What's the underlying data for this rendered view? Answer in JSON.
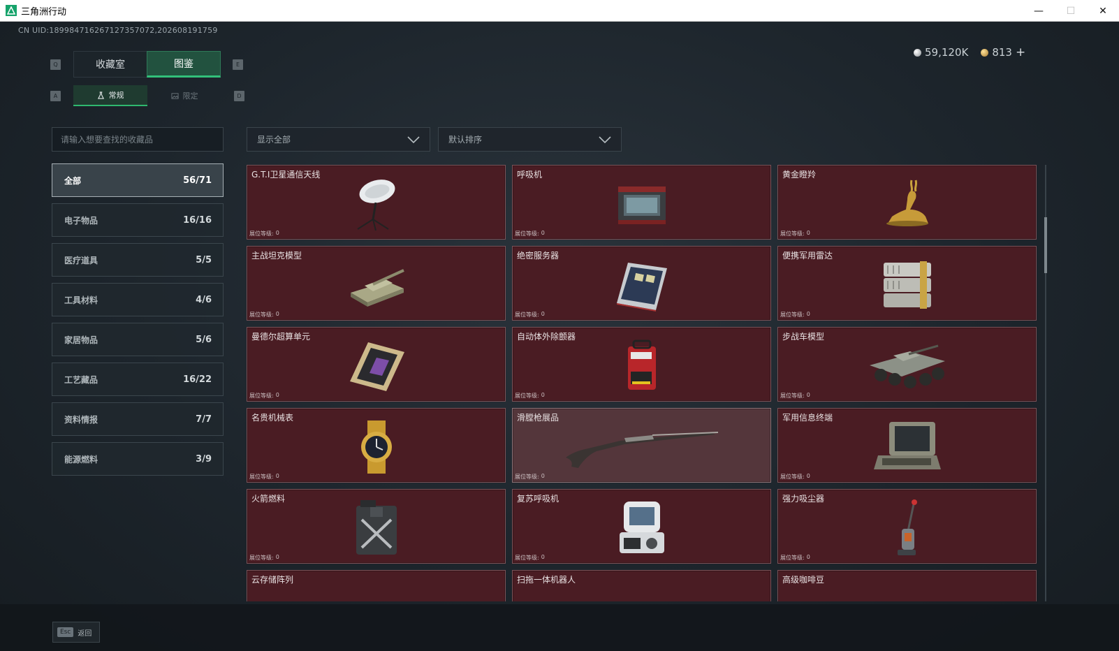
{
  "window": {
    "title": "三角洲行动",
    "minimize": "—",
    "maximize": "☐",
    "close": "✕"
  },
  "uid": "CN UID:18998471626712735707​2,202608191759",
  "currency": {
    "silver": "59,120K",
    "gold": "813",
    "add": "+"
  },
  "tabs": {
    "key_left": "Q",
    "key_right": "E",
    "items": [
      {
        "label": "收藏室"
      },
      {
        "label": "图鉴"
      }
    ]
  },
  "subtabs": {
    "key_left": "A",
    "key_right": "D",
    "items": [
      {
        "label": "常规"
      },
      {
        "label": "限定"
      }
    ]
  },
  "search": {
    "placeholder": "请输入想要查找的收藏品"
  },
  "filters": {
    "show": "显示全部",
    "sort": "默认排序"
  },
  "categories": [
    {
      "label": "全部",
      "count": "56/71"
    },
    {
      "label": "电子物品",
      "count": "16/16"
    },
    {
      "label": "医疗道具",
      "count": "5/5"
    },
    {
      "label": "工具材料",
      "count": "4/6"
    },
    {
      "label": "家居物品",
      "count": "5/6"
    },
    {
      "label": "工艺藏品",
      "count": "16/22"
    },
    {
      "label": "资料情报",
      "count": "7/7"
    },
    {
      "label": "能源燃料",
      "count": "3/9"
    }
  ],
  "items": [
    {
      "name": "G.T.I卫星通信天线",
      "level_label": "展位等级:",
      "level": "0",
      "icon": "satellite-dish-icon"
    },
    {
      "name": "呼吸机",
      "level_label": "展位等级:",
      "level": "0",
      "icon": "ventilator-icon"
    },
    {
      "name": "黄金瞪羚",
      "level_label": "展位等级:",
      "level": "0",
      "icon": "gold-gazelle-icon"
    },
    {
      "name": "主战坦克模型",
      "level_label": "展位等级:",
      "level": "0",
      "icon": "tank-model-icon"
    },
    {
      "name": "绝密服务器",
      "level_label": "展位等级:",
      "level": "0",
      "icon": "server-icon"
    },
    {
      "name": "便携军用雷达",
      "level_label": "展位等级:",
      "level": "0",
      "icon": "radar-icon"
    },
    {
      "name": "曼德尔超算单元",
      "level_label": "展位等级:",
      "level": "0",
      "icon": "supercomputer-unit-icon"
    },
    {
      "name": "自动体外除颤器",
      "level_label": "展位等级:",
      "level": "0",
      "icon": "defibrillator-icon"
    },
    {
      "name": "步战车模型",
      "level_label": "展位等级:",
      "level": "0",
      "icon": "ifv-model-icon"
    },
    {
      "name": "名贵机械表",
      "level_label": "展位等级:",
      "level": "0",
      "icon": "watch-icon"
    },
    {
      "name": "滑膛枪展品",
      "level_label": "展位等级:",
      "level": "0",
      "icon": "musket-icon"
    },
    {
      "name": "军用信息终端",
      "level_label": "展位等级:",
      "level": "0",
      "icon": "terminal-icon"
    },
    {
      "name": "火箭燃料",
      "level_label": "展位等级:",
      "level": "0",
      "icon": "fuel-can-icon"
    },
    {
      "name": "复苏呼吸机",
      "level_label": "展位等级:",
      "level": "0",
      "icon": "resuscitator-icon"
    },
    {
      "name": "强力吸尘器",
      "level_label": "展位等级:",
      "level": "0",
      "icon": "vacuum-icon"
    },
    {
      "name": "云存储阵列",
      "level_label": "",
      "level": "",
      "icon": ""
    },
    {
      "name": "扫拖一体机器人",
      "level_label": "",
      "level": "",
      "icon": ""
    },
    {
      "name": "高级咖啡豆",
      "level_label": "",
      "level": "",
      "icon": ""
    }
  ],
  "footer": {
    "key": "Esc",
    "label": "返回"
  }
}
